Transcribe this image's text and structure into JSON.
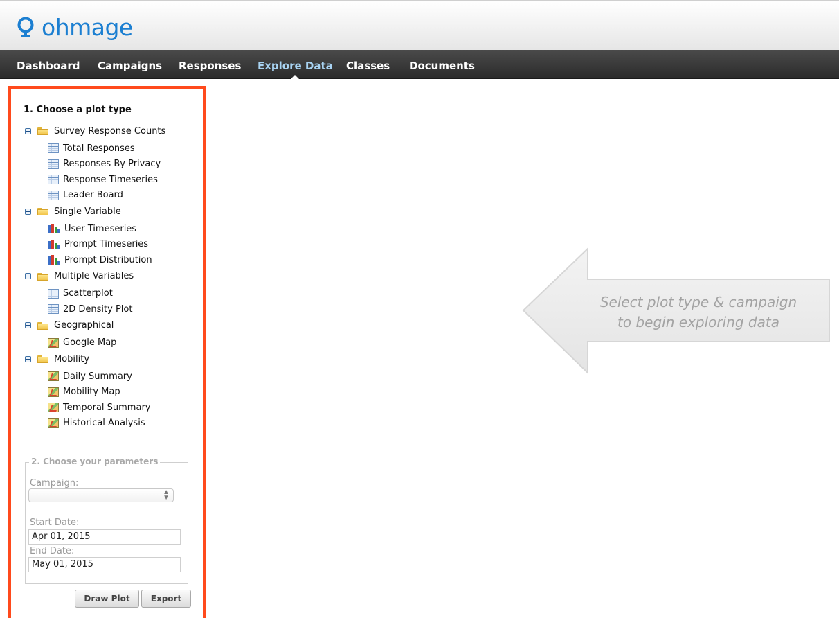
{
  "app": {
    "logo_text": "ohmage"
  },
  "nav": {
    "items": [
      {
        "label": "Dashboard"
      },
      {
        "label": "Campaigns"
      },
      {
        "label": "Responses"
      },
      {
        "label": "Explore Data"
      },
      {
        "label": "Classes"
      },
      {
        "label": "Documents"
      }
    ],
    "active": "Explore Data"
  },
  "sidebar": {
    "section1_title": "1. Choose a plot type",
    "tree": [
      {
        "label": "Survey Response Counts",
        "icon": "folder-icon",
        "children": [
          {
            "label": "Total Responses",
            "icon": "table-icon"
          },
          {
            "label": "Responses By Privacy",
            "icon": "table-icon"
          },
          {
            "label": "Response Timeseries",
            "icon": "table-icon"
          },
          {
            "label": "Leader Board",
            "icon": "table-icon"
          }
        ]
      },
      {
        "label": "Single Variable",
        "icon": "folder-icon",
        "children": [
          {
            "label": "User Timeseries",
            "icon": "bar-chart-icon"
          },
          {
            "label": "Prompt Timeseries",
            "icon": "bar-chart-icon"
          },
          {
            "label": "Prompt Distribution",
            "icon": "bar-chart-icon"
          }
        ]
      },
      {
        "label": "Multiple Variables",
        "icon": "folder-icon",
        "children": [
          {
            "label": "Scatterplot",
            "icon": "table-icon"
          },
          {
            "label": "2D Density Plot",
            "icon": "table-icon"
          }
        ]
      },
      {
        "label": "Geographical",
        "icon": "folder-icon",
        "children": [
          {
            "label": "Google Map",
            "icon": "map-icon"
          }
        ]
      },
      {
        "label": "Mobility",
        "icon": "folder-icon",
        "children": [
          {
            "label": "Daily Summary",
            "icon": "map-icon"
          },
          {
            "label": "Mobility Map",
            "icon": "map-icon"
          },
          {
            "label": "Temporal Summary",
            "icon": "map-icon"
          },
          {
            "label": "Historical Analysis",
            "icon": "map-icon"
          }
        ]
      }
    ],
    "params": {
      "legend": "2. Choose your parameters",
      "campaign_label": "Campaign:",
      "campaign_value": "",
      "start_label": "Start Date:",
      "start_value": "Apr 01, 2015",
      "end_label": "End Date:",
      "end_value": "May 01, 2015"
    },
    "buttons": {
      "draw": "Draw Plot",
      "export": "Export"
    }
  },
  "hint": {
    "line1": "Select plot type & campaign",
    "line2": "to begin exploring data"
  },
  "colors": {
    "accent": "#1c7fd1",
    "highlight_border": "#ff4a1c",
    "nav_active": "#a8d3f2"
  }
}
